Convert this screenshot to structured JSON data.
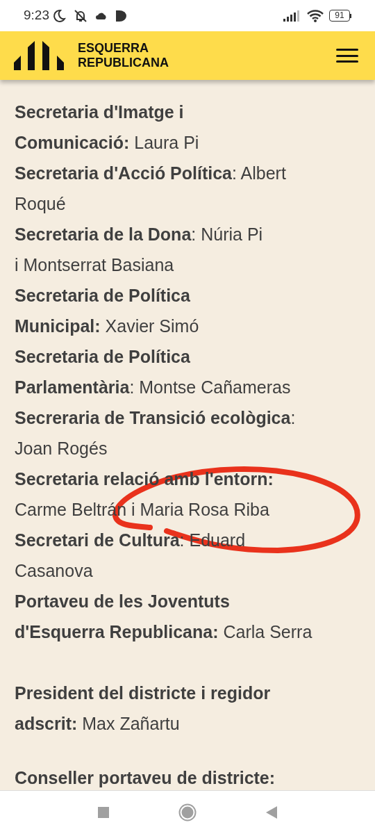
{
  "status_bar": {
    "time": "9:23",
    "battery": "91"
  },
  "header": {
    "logo_lines": [
      "ESQUERRA",
      "REPUBLICANA"
    ]
  },
  "content": [
    {
      "lines": [
        "**Secretaria d'Imatge i**",
        "**Comunicació:** Laura Pi",
        "**Secretaria d'Acció Política**: Albert",
        "Roqué",
        "**Secretaria de la Dona**: Núria Pi",
        "i Montserrat Basiana",
        "**Secretaria de Política**",
        "**Municipal:** Xavier Simó",
        "**Secretaria de Política**",
        "**Parlamentària**: Montse Cañameras",
        "**Secreraria de Transició ecològica**:",
        "Joan Rogés",
        "**Secretaria relació amb l'entorn:**",
        "Carme Beltrán i Maria Rosa Riba",
        "**Secretari de Cultura**: Eduard",
        "Casanova",
        "**Portaveu de les Joventuts**",
        "**d'Esquerra Republicana:** Carla Serra"
      ]
    },
    {
      "lines": [
        "**President del districte i regidor**",
        "**adscrit:** Max Zañartu"
      ]
    },
    {
      "lines": [
        "**Conseller portaveu de districte:**"
      ]
    }
  ]
}
